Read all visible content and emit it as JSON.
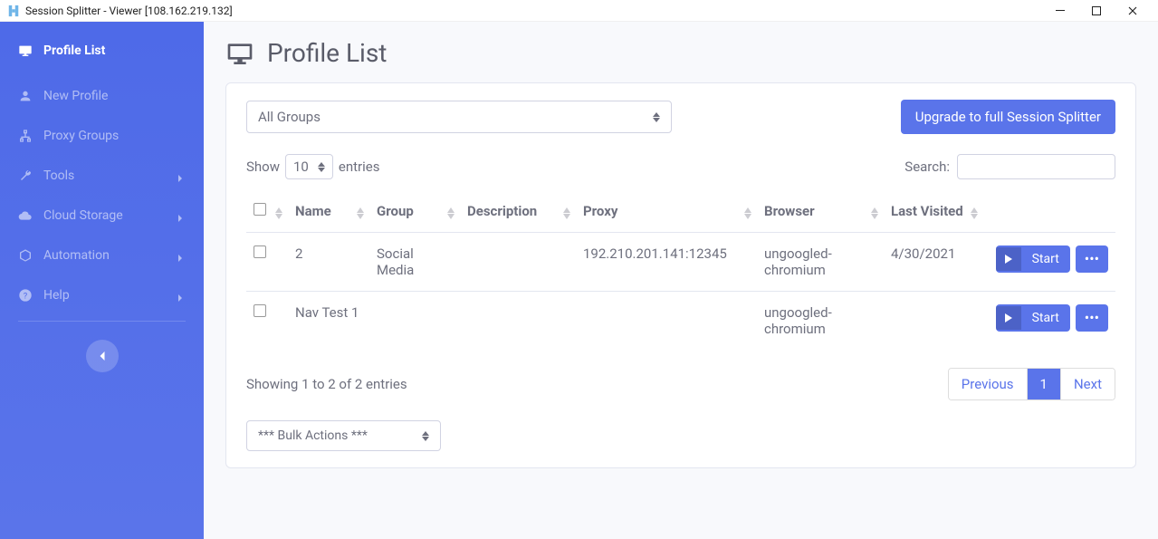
{
  "window": {
    "title": "Session Splitter - Viewer [108.162.219.132]"
  },
  "sidebar": {
    "items": [
      {
        "label": "Profile List",
        "icon": "monitor",
        "chevron": false,
        "active": true
      },
      {
        "label": "New Profile",
        "icon": "user",
        "chevron": false,
        "active": false
      },
      {
        "label": "Proxy Groups",
        "icon": "sitemap",
        "chevron": false,
        "active": false
      },
      {
        "label": "Tools",
        "icon": "wrench",
        "chevron": true,
        "active": false
      },
      {
        "label": "Cloud Storage",
        "icon": "cloud",
        "chevron": true,
        "active": false
      },
      {
        "label": "Automation",
        "icon": "cube",
        "chevron": true,
        "active": false
      },
      {
        "label": "Help",
        "icon": "help",
        "chevron": true,
        "active": false
      }
    ]
  },
  "page": {
    "title": "Profile List"
  },
  "filter": {
    "group_selected": "All Groups"
  },
  "upgrade_button": "Upgrade to full Session Splitter",
  "table": {
    "show_label": "Show",
    "entries_label": "entries",
    "entries_value": "10",
    "search_label": "Search:",
    "columns": [
      "",
      "Name",
      "Group",
      "Description",
      "Proxy",
      "Browser",
      "Last Visited",
      ""
    ],
    "rows": [
      {
        "name": "2",
        "group": "Social Media",
        "description": "",
        "proxy": "192.210.201.141:12345",
        "browser": "ungoogled-chromium",
        "last_visited": "4/30/2021"
      },
      {
        "name": "Nav Test 1",
        "group": "",
        "description": "",
        "proxy": "",
        "browser": "ungoogled-chromium",
        "last_visited": ""
      }
    ],
    "start_label": "Start",
    "info": "Showing 1 to 2 of 2 entries",
    "pager": {
      "prev": "Previous",
      "page": "1",
      "next": "Next"
    }
  },
  "bulk": {
    "label": "*** Bulk Actions ***"
  }
}
